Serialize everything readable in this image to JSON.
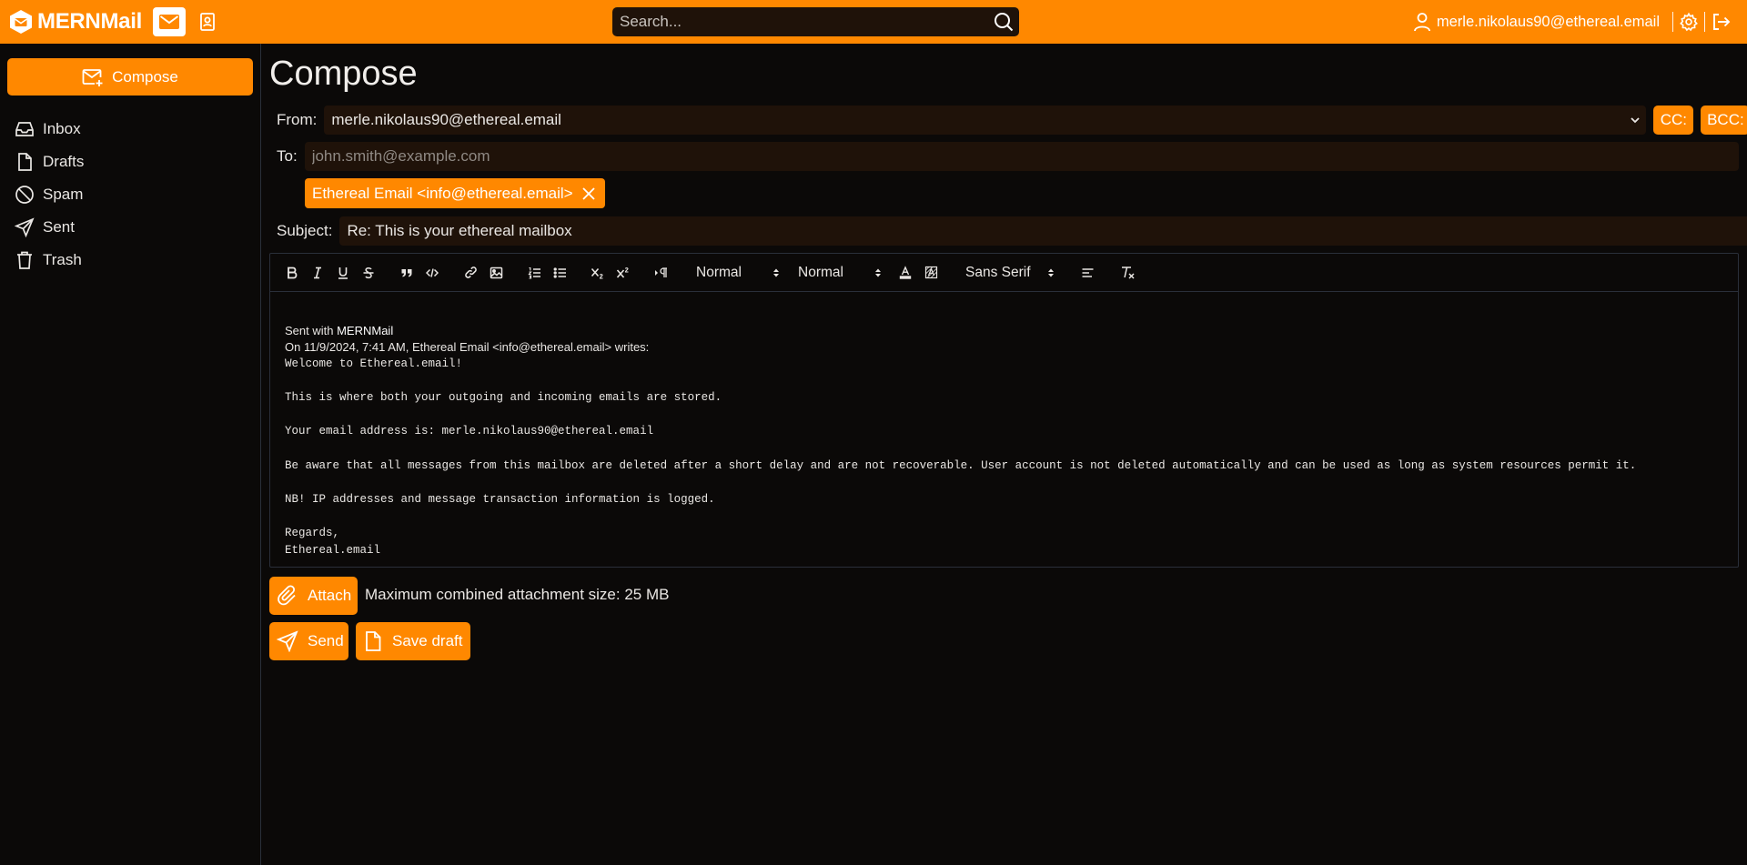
{
  "app": {
    "name": "MERNMail"
  },
  "header": {
    "search_placeholder": "Search...",
    "user_email": "merle.nikolaus90@ethereal.email",
    "icons": [
      "mernmail-logo-icon",
      "mail-icon",
      "contacts-icon",
      "search-icon",
      "user-icon",
      "gear-icon",
      "logout-icon"
    ]
  },
  "sidebar": {
    "compose_label": "Compose",
    "items": [
      {
        "label": "Inbox",
        "icon": "inbox-icon"
      },
      {
        "label": "Drafts",
        "icon": "file-icon"
      },
      {
        "label": "Spam",
        "icon": "ban-icon"
      },
      {
        "label": "Sent",
        "icon": "send-icon"
      },
      {
        "label": "Trash",
        "icon": "trash-icon"
      }
    ]
  },
  "compose": {
    "title": "Compose",
    "from_label": "From:",
    "from_value": "merle.nikolaus90@ethereal.email",
    "cc_label": "CC:",
    "bcc_label": "BCC:",
    "to_label": "To:",
    "to_placeholder": "john.smith@example.com",
    "recipient_chip": "Ethereal Email <info@ethereal.email>",
    "subject_label": "Subject:",
    "subject_value": "Re: This is your ethereal mailbox",
    "toolbar": {
      "header_select": "Normal",
      "size_select": "Normal",
      "font_select": "Sans Serif"
    },
    "body": {
      "sent_with_prefix": "Sent with ",
      "sent_with_app": "MERNMail",
      "quote_intro": "On 11/9/2024, 7:41 AM, Ethereal Email <info@ethereal.email> writes:",
      "line1": "Welcome to Ethereal.email!",
      "line2": "This is where both your outgoing and incoming emails are stored.",
      "line3": "Your email address is: merle.nikolaus90@ethereal.email",
      "line4": "Be aware that all messages from this mailbox are deleted after a short delay and are not recoverable. User account is not deleted automatically and can be used as long as system resources permit it.",
      "line5": "NB! IP addresses and message transaction information is logged.",
      "line6": "Regards,",
      "line7": "Ethereal.email"
    },
    "attach_label": "Attach",
    "attach_note": "Maximum combined attachment size: 25 MB",
    "send_label": "Send",
    "save_draft_label": "Save draft"
  },
  "colors": {
    "accent": "#ff8800",
    "background": "#0b0908",
    "field": "#1f1209",
    "border": "#2a2f3a"
  }
}
